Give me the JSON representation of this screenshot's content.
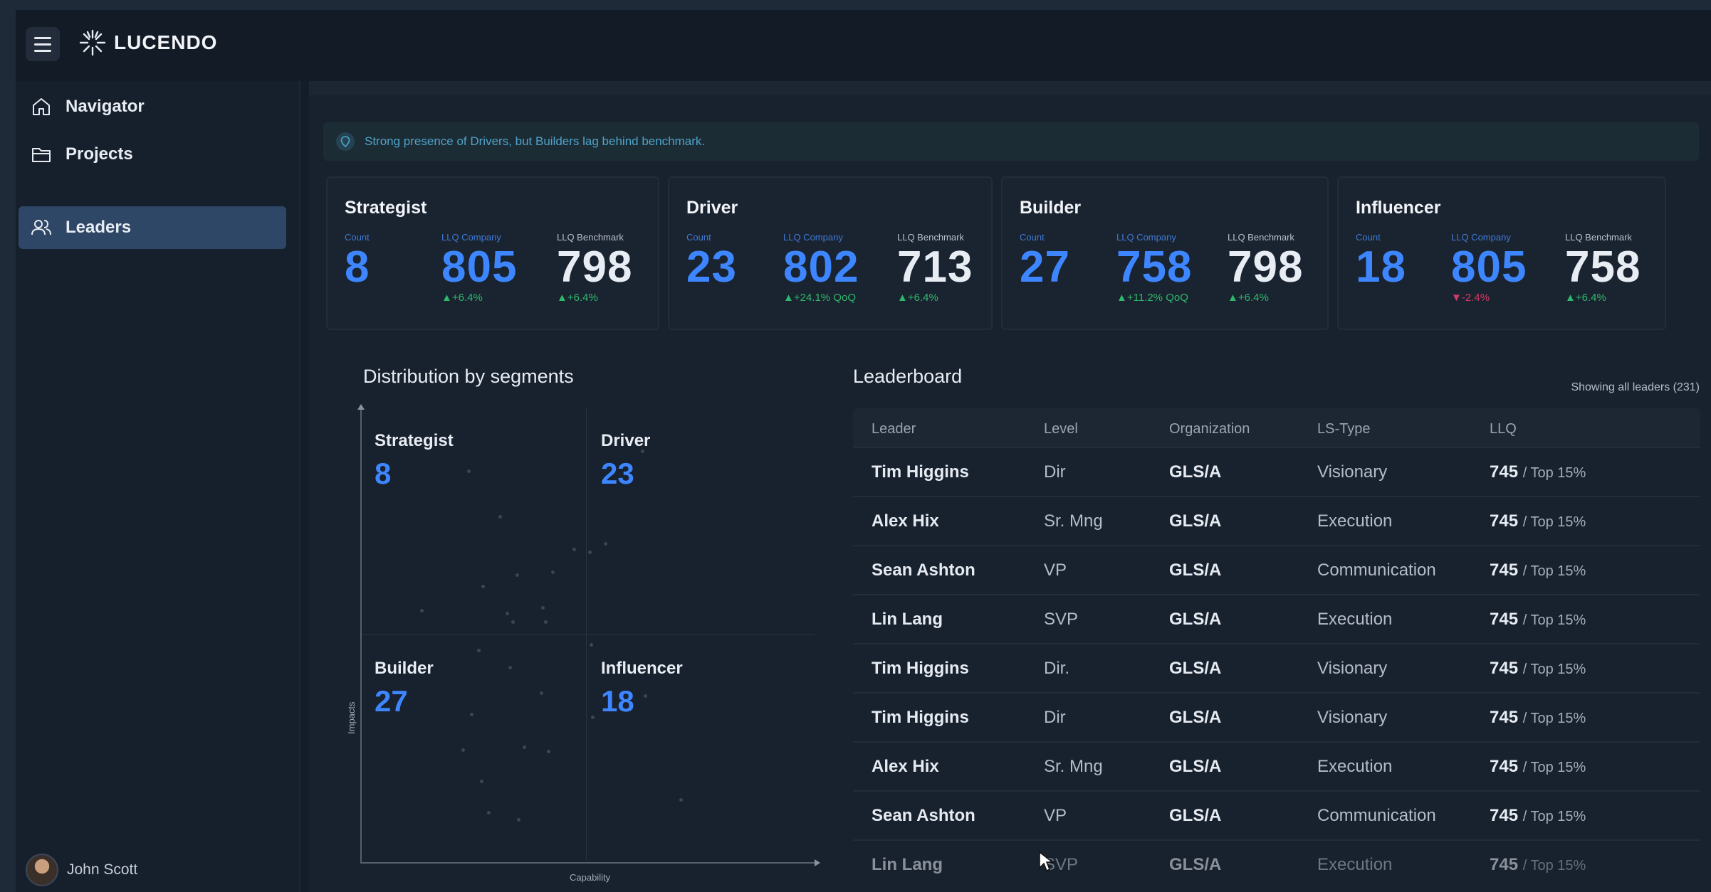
{
  "app": {
    "name": "LUCENDO"
  },
  "sidebar": {
    "items": [
      {
        "label": "Navigator",
        "icon": "home-icon"
      },
      {
        "label": "Projects",
        "icon": "folder-icon"
      },
      {
        "label": "Leaders",
        "icon": "users-icon",
        "active": true
      }
    ],
    "user": {
      "name": "John Scott"
    }
  },
  "insight": {
    "text": "Strong presence of Drivers, but Builders lag behind benchmark."
  },
  "cards": [
    {
      "title": "Strategist",
      "count_label": "Count",
      "count": "8",
      "company_label": "LLQ Company",
      "company": "805",
      "company_delta": "▲+6.4%",
      "company_delta_dir": "up",
      "bench_label": "LLQ Benchmark",
      "bench": "798",
      "bench_delta": "▲+6.4%"
    },
    {
      "title": "Driver",
      "count_label": "Count",
      "count": "23",
      "company_label": "LLQ Company",
      "company": "802",
      "company_delta": "▲+24.1% QoQ",
      "company_delta_dir": "up",
      "bench_label": "LLQ Benchmark",
      "bench": "713",
      "bench_delta": "▲+6.4%"
    },
    {
      "title": "Builder",
      "count_label": "Count",
      "count": "27",
      "company_label": "LLQ Company",
      "company": "758",
      "company_delta": "▲+11.2% QoQ",
      "company_delta_dir": "up",
      "bench_label": "LLQ Benchmark",
      "bench": "798",
      "bench_delta": "▲+6.4%"
    },
    {
      "title": "Influencer",
      "count_label": "Count",
      "count": "18",
      "company_label": "LLQ Company",
      "company": "805",
      "company_delta": "▼-2.4%",
      "company_delta_dir": "down",
      "bench_label": "LLQ Benchmark",
      "bench": "758",
      "bench_delta": "▲+6.4%"
    }
  ],
  "distribution": {
    "title": "Distribution by segments",
    "x_label": "Capability",
    "y_label": "Impacts",
    "quadrants": [
      {
        "label": "Strategist",
        "count": "8"
      },
      {
        "label": "Driver",
        "count": "23"
      },
      {
        "label": "Builder",
        "count": "27"
      },
      {
        "label": "Influencer",
        "count": "18"
      }
    ]
  },
  "leaderboard": {
    "title": "Leaderboard",
    "note": "Showing all leaders (231)",
    "columns": [
      "Leader",
      "Level",
      "Organization",
      "LS-Type",
      "LLQ"
    ],
    "rows": [
      {
        "leader": "Tim Higgins",
        "level": "Dir",
        "org": "GLS/A",
        "type": "Visionary",
        "llq": "745",
        "rank": "/ Top 15%"
      },
      {
        "leader": "Alex Hix",
        "level": "Sr. Mng",
        "org": "GLS/A",
        "type": "Execution",
        "llq": "745",
        "rank": "/ Top 15%"
      },
      {
        "leader": "Sean Ashton",
        "level": "VP",
        "org": "GLS/A",
        "type": "Communication",
        "llq": "745",
        "rank": "/ Top 15%"
      },
      {
        "leader": "Lin Lang",
        "level": "SVP",
        "org": "GLS/A",
        "type": "Execution",
        "llq": "745",
        "rank": "/ Top 15%"
      },
      {
        "leader": "Tim Higgins",
        "level": "Dir.",
        "org": "GLS/A",
        "type": "Visionary",
        "llq": "745",
        "rank": "/ Top 15%"
      },
      {
        "leader": "Tim Higgins",
        "level": "Dir",
        "org": "GLS/A",
        "type": "Visionary",
        "llq": "745",
        "rank": "/ Top 15%"
      },
      {
        "leader": "Alex Hix",
        "level": "Sr. Mng",
        "org": "GLS/A",
        "type": "Execution",
        "llq": "745",
        "rank": "/ Top 15%"
      },
      {
        "leader": "Sean Ashton",
        "level": "VP",
        "org": "GLS/A",
        "type": "Communication",
        "llq": "745",
        "rank": "/ Top 15%"
      },
      {
        "leader": "Lin Lang",
        "level": "SVP",
        "org": "GLS/A",
        "type": "Execution",
        "llq": "745",
        "rank": "/ Top 15%"
      }
    ]
  },
  "colors": {
    "accent": "#3d86ff",
    "positive": "#2fb86b",
    "negative": "#d23b66",
    "active_nav": "#2f4766"
  }
}
